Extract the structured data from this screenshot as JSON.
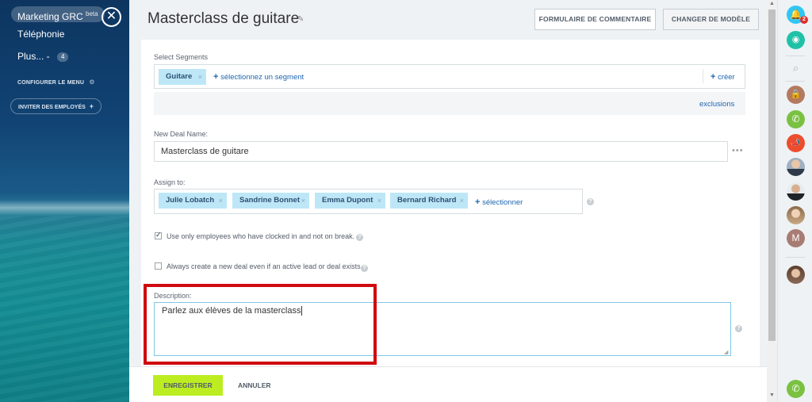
{
  "sidebar": {
    "active_item": "Marketing GRC",
    "active_item_tag": "beta",
    "items": [
      {
        "label": "Téléphonie"
      },
      {
        "label": "Plus... -",
        "count": "4"
      }
    ],
    "configure_menu": "CONFIGURER LE MENU",
    "invite_employees": "INVITER DES EMPLOYÉS",
    "invite_plus": "+",
    "close_symbol": "✕"
  },
  "header": {
    "title": "Masterclass de guitare",
    "edit_icon": "pencil-icon",
    "feedback_button": "FORMULAIRE DE COMMENTAIRE",
    "change_template_button": "CHANGER DE MODÈLE"
  },
  "form": {
    "segments": {
      "label": "Select Segments",
      "tags": [
        "Guitare"
      ],
      "select_link": "sélectionnez un segment",
      "create_link": "créer",
      "exclusions_link": "exclusions"
    },
    "deal_name": {
      "label": "New Deal Name:",
      "value": "Masterclass de guitare",
      "more": "•••"
    },
    "assign": {
      "label": "Assign to:",
      "tags": [
        "Julie Lobatch",
        "Sandrine Bonnet",
        "Emma Dupont",
        "Bernard Richard"
      ],
      "select_link": "sélectionner"
    },
    "option_clocked_in": {
      "label": "Use only employees who have clocked in and not on break.",
      "checked": true
    },
    "option_new_deal": {
      "label": "Always create a new deal even if an active lead or deal exists",
      "checked": false
    },
    "description": {
      "label": "Description:",
      "value": "Parlez aux élèves de la masterclass"
    },
    "help_symbol": "?",
    "remove_symbol": "×",
    "plus_symbol": "+"
  },
  "footer": {
    "save_button": "ENREGISTRER",
    "cancel_button": "ANNULER"
  },
  "right_rail": {
    "notification_count": "2",
    "avatar_letter": "M",
    "icons": [
      "bell-icon",
      "chat-icon",
      "search-icon",
      "lock-icon",
      "phone-icon",
      "megaphone-icon",
      "phone-call-icon"
    ]
  },
  "colors": {
    "accent_green": "#bbed21",
    "tag_blue": "#bde7f7",
    "highlight_red": "#d0090f",
    "link_blue": "#2067b0"
  }
}
